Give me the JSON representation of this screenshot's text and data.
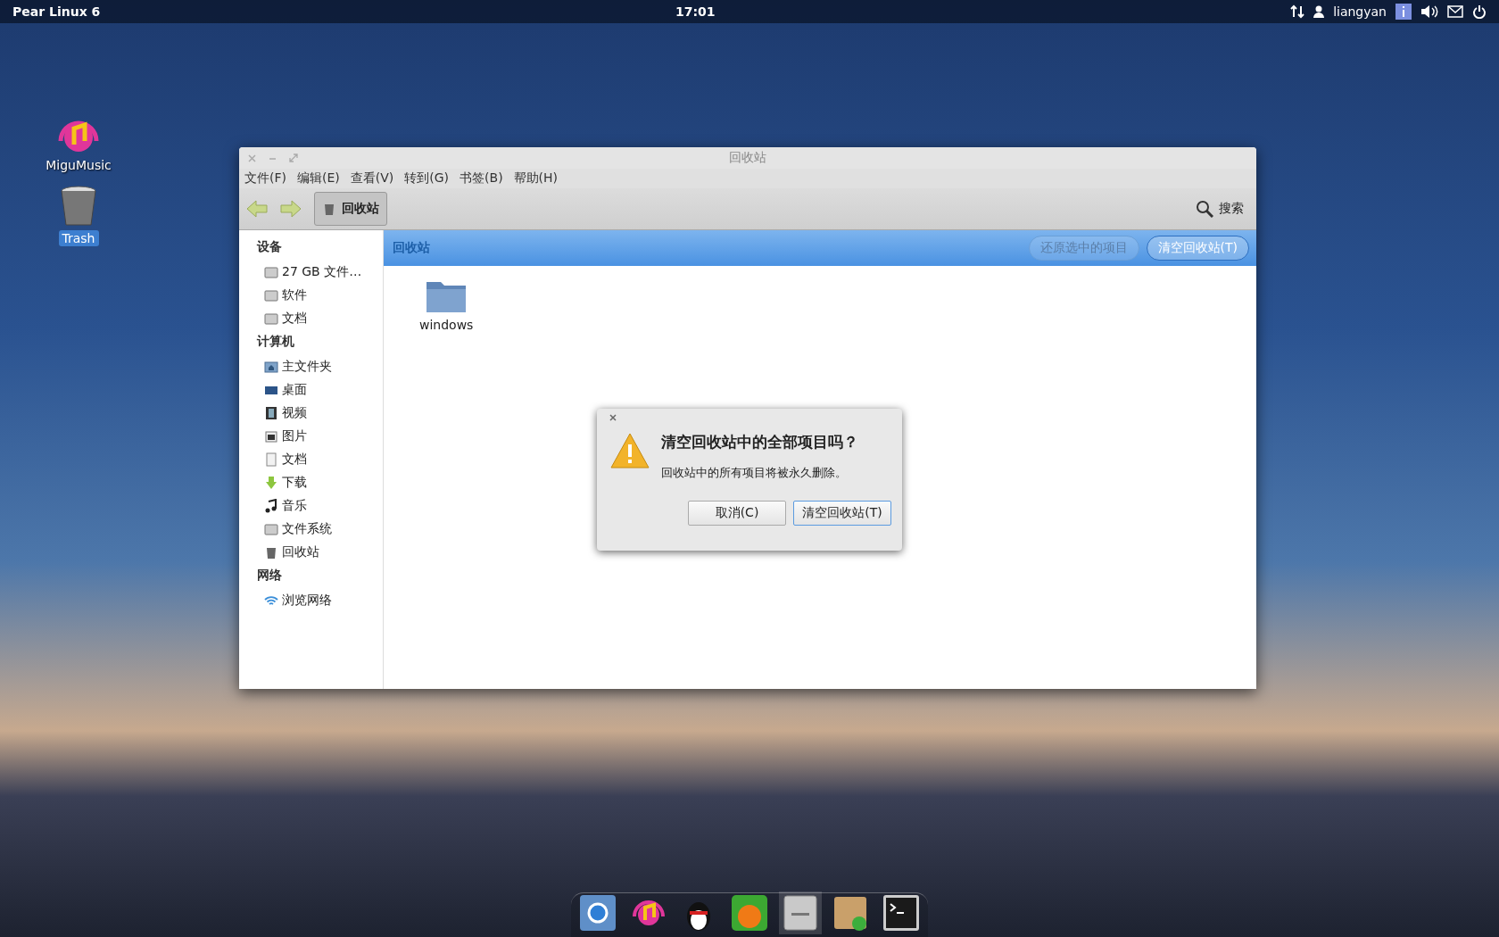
{
  "top_bar": {
    "distro": "Pear Linux 6",
    "clock": "17:01",
    "user": "liangyan"
  },
  "desktop_icons": [
    {
      "label": "MiguMusic",
      "kind": "music",
      "selected": false
    },
    {
      "label": "Trash",
      "kind": "trash",
      "selected": true
    }
  ],
  "window": {
    "title": "回收站",
    "menu": [
      "文件(F)",
      "编辑(E)",
      "查看(V)",
      "转到(G)",
      "书签(B)",
      "帮助(H)"
    ],
    "breadcrumb": "回收站",
    "search": "搜索",
    "sidebar": [
      {
        "heading": "设备",
        "items": [
          {
            "label": "27 GB 文件…",
            "kind": "drive"
          },
          {
            "label": "软件",
            "kind": "drive"
          },
          {
            "label": "文档",
            "kind": "drive"
          }
        ]
      },
      {
        "heading": "计算机",
        "items": [
          {
            "label": "主文件夹",
            "kind": "home"
          },
          {
            "label": "桌面",
            "kind": "desktop"
          },
          {
            "label": "视频",
            "kind": "video"
          },
          {
            "label": "图片",
            "kind": "picture"
          },
          {
            "label": "文档",
            "kind": "document"
          },
          {
            "label": "下载",
            "kind": "download"
          },
          {
            "label": "音乐",
            "kind": "music"
          },
          {
            "label": "文件系统",
            "kind": "drive"
          },
          {
            "label": "回收站",
            "kind": "trash"
          }
        ]
      },
      {
        "heading": "网络",
        "items": [
          {
            "label": "浏览网络",
            "kind": "network"
          }
        ]
      }
    ],
    "location": "回收站",
    "actions": [
      {
        "label": "还原选中的项目",
        "disabled": true
      },
      {
        "label": "清空回收站(T)",
        "disabled": false
      }
    ],
    "files": [
      {
        "name": "windows"
      }
    ]
  },
  "dialog": {
    "title": "清空回收站中的全部项目吗？",
    "message": "回收站中的所有项目将被永久删除。",
    "buttons": [
      {
        "label": "取消(C)",
        "default": false
      },
      {
        "label": "清空回收站(T)",
        "default": true
      }
    ]
  },
  "dock": [
    {
      "kind": "browser",
      "running": false
    },
    {
      "kind": "music",
      "running": false
    },
    {
      "kind": "penguin",
      "running": false
    },
    {
      "kind": "video",
      "running": false
    },
    {
      "kind": "cabinet",
      "running": true
    },
    {
      "kind": "package",
      "running": false
    },
    {
      "kind": "terminal",
      "running": false
    }
  ]
}
